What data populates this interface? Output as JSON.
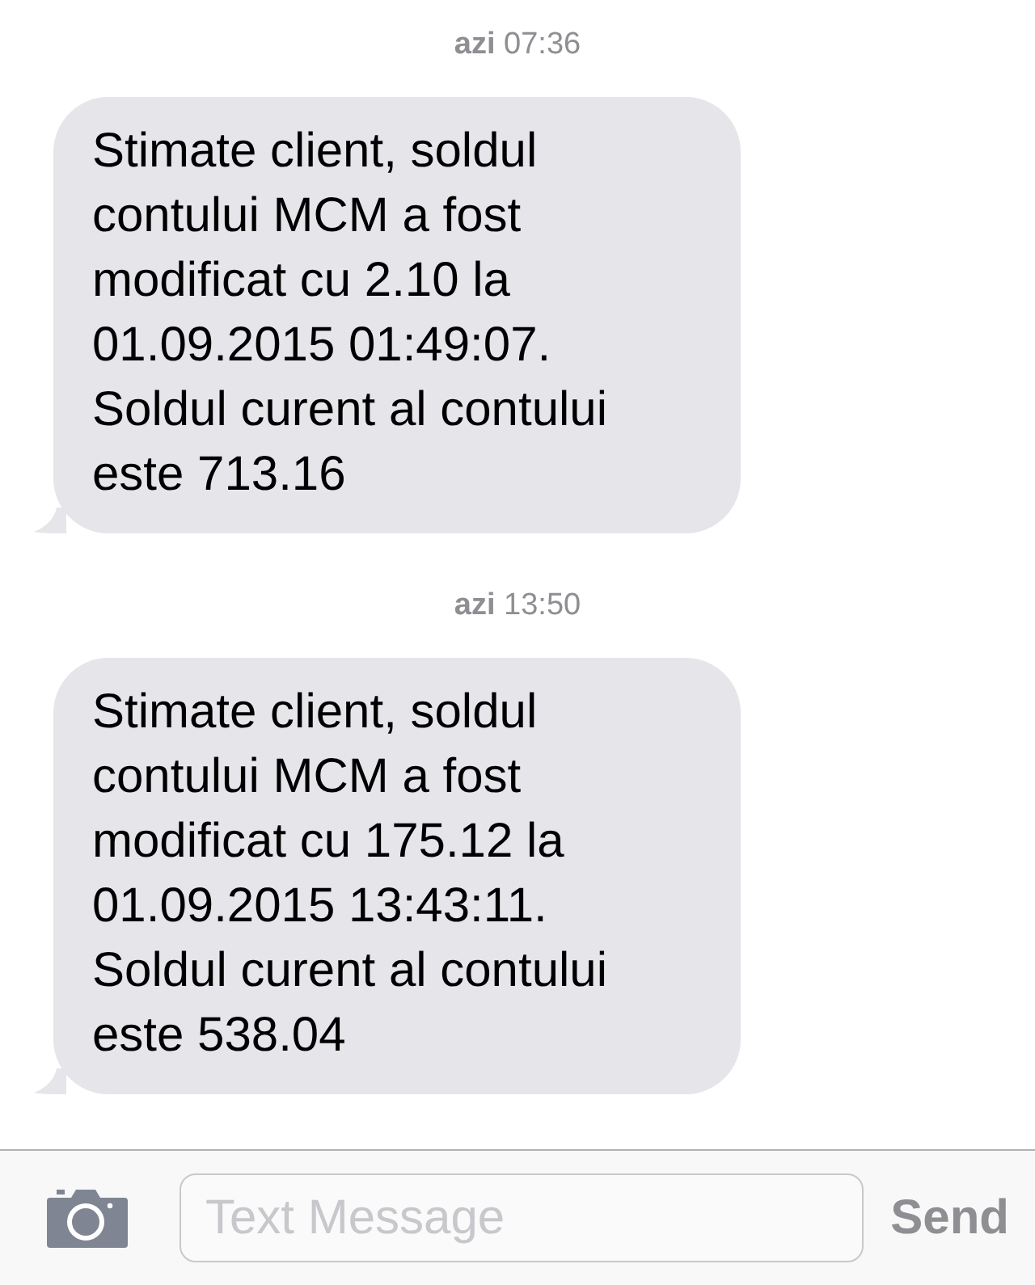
{
  "messages": [
    {
      "timestamp": "**azi** 07:36",
      "text": "Stimate client, soldul\ncontului MCM a fost\nmodificat cu 2.10 la\n01.09.2015 01:49:07.\nSoldul curent al contului\neste 713.16"
    },
    {
      "timestamp": "**azi** 13:50",
      "text": "Stimate client, soldul\ncontului MCM a fost\nmodificat cu 175.12 la\n01.09.2015 13:43:11.\nSoldul curent al contului\neste 538.04"
    }
  ],
  "composer": {
    "placeholder": "Text Message",
    "send": "Send"
  }
}
